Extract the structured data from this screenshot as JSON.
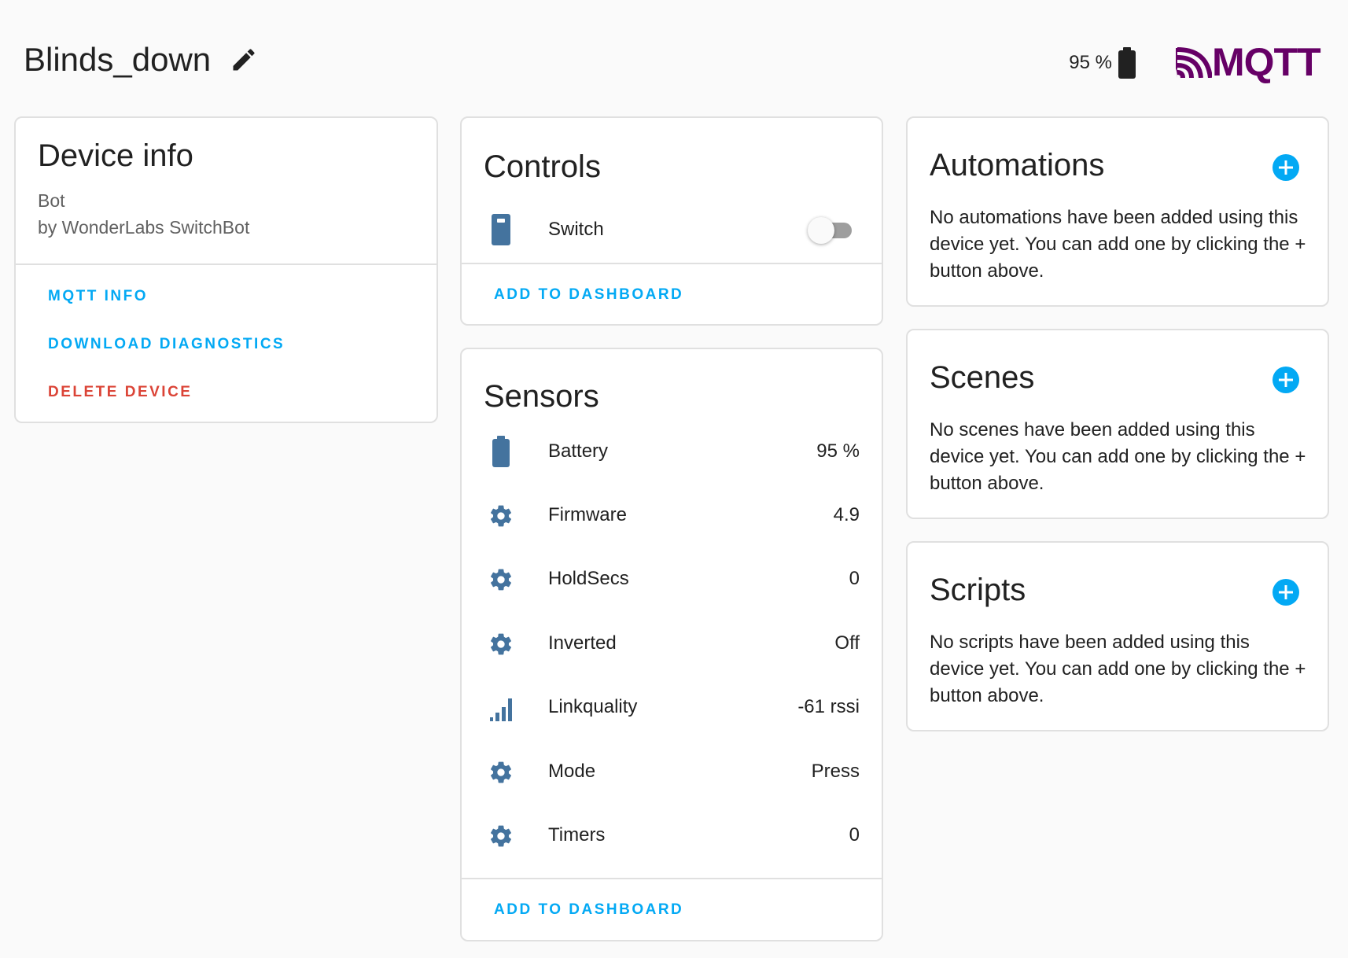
{
  "header": {
    "title": "Blinds_down",
    "battery": "95 %",
    "logo_text": "MQTT",
    "logo_color": "#660066"
  },
  "device_info": {
    "title": "Device info",
    "model": "Bot",
    "manufacturer": "by WonderLabs SwitchBot",
    "actions": [
      "MQTT INFO",
      "DOWNLOAD DIAGNOSTICS",
      "DELETE DEVICE"
    ]
  },
  "controls": {
    "title": "Controls",
    "switch": {
      "label": "Switch",
      "state": "off",
      "icon": "switch-icon"
    },
    "add_to_dashboard": "ADD TO DASHBOARD"
  },
  "sensors": {
    "title": "Sensors",
    "rows": [
      {
        "label": "Battery",
        "value": "95 %",
        "icon": "battery-icon"
      },
      {
        "label": "Firmware",
        "value": "4.9",
        "icon": "gear-icon"
      },
      {
        "label": "HoldSecs",
        "value": "0",
        "icon": "gear-icon"
      },
      {
        "label": "Inverted",
        "value": "Off",
        "icon": "gear-icon"
      },
      {
        "label": "Linkquality",
        "value": "-61 rssi",
        "icon": "signal-icon"
      },
      {
        "label": "Mode",
        "value": "Press",
        "icon": "gear-icon"
      },
      {
        "label": "Timers",
        "value": "0",
        "icon": "gear-icon"
      }
    ],
    "add_to_dashboard": "ADD TO DASHBOARD"
  },
  "automations": {
    "title": "Automations",
    "body": "No automations have been added using this device yet. You can add one by clicking the + button above."
  },
  "scenes": {
    "title": "Scenes",
    "body": "No scenes have been added using this device yet. You can add one by clicking the + button above."
  },
  "scripts": {
    "title": "Scripts",
    "body": "No scripts have been added using this device yet. You can add one by clicking the + button above."
  },
  "colors": {
    "accent": "#03a9f4",
    "danger": "#db4437",
    "icon": "#44739e"
  }
}
